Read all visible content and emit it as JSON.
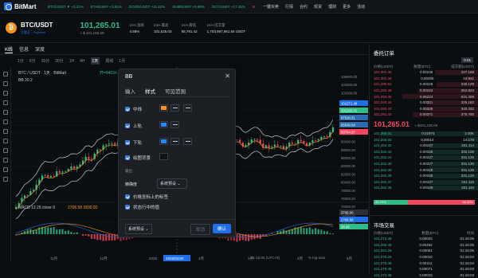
{
  "brand": "BitMart",
  "ticker": [
    {
      "t": "BTC/USDT ▼ +3.31%",
      "c": "up"
    },
    {
      "t": "ETH/USDT +3.81%",
      "c": "up"
    },
    {
      "t": "DOGE/USDT +11.62%",
      "c": "up"
    },
    {
      "t": "SHIB/USDT +9.96%",
      "c": "up"
    },
    {
      "t": "OCT/USDT +17.15%",
      "c": "up"
    },
    {
      "t": "BMX/USDT -1.35%",
      "c": "dn"
    }
  ],
  "topnav": [
    "一键买卖",
    "行情",
    "合约",
    "现货",
    "理财",
    "更多",
    "活动"
  ],
  "pair": {
    "name": "BTC/USDT",
    "sub": "主要区 · Payment",
    "price": "101,265.01",
    "sub_price": "≈ $ 101,236.59",
    "change_label": "24H 涨跌",
    "change": "4.58%",
    "high_label": "24H 最高",
    "high": "101,525.03",
    "low_label": "24H 最低",
    "low": "95,791.42",
    "vol_label": "24H 成交量",
    "vol": "1,703,997,961.64 USDT"
  },
  "chart_tabs": [
    "K线",
    "信息",
    "深度"
  ],
  "timeframes": [
    "1分",
    "5分",
    "15分",
    "30分",
    "1H",
    "4H",
    "1天",
    "周线",
    "1月"
  ],
  "selected_timeframe": "1天",
  "months": [
    "11月",
    "12月",
    "2025",
    "2月",
    "3月",
    "4月",
    "5月"
  ],
  "x_highlight": "2025/01/20",
  "chart_legend": "BTC / USDT · 1天 · BitMart",
  "ohlc": "开=94034.92 高=101535.73 低=...",
  "bb_label": "BB 20 2",
  "macd_label": "MACD 12 26 close 9",
  "macd_values": "2706.58  2830.92",
  "y_ticks": [
    "106000.00",
    "104000.00",
    "102000.00",
    "100000.00",
    "98000.00",
    "96000.00",
    "94000.00",
    "92000.00",
    "90000.00",
    "88000.00",
    "86000.00",
    "84000.00",
    "82000.00",
    "80000.00",
    "78000.00",
    "76000.00",
    "74000.00",
    "72000.00",
    "70000.00"
  ],
  "price_tags": [
    {
      "v": "101271.48",
      "c": "#1f6feb"
    },
    {
      "v": "101265.01",
      "c": "#2ebd85"
    },
    {
      "v": "97530.51",
      "c": "#2b6cb0"
    },
    {
      "v": "95630.64",
      "c": "#2b6cb0"
    },
    {
      "v": "93794.97",
      "c": "#f6465d"
    }
  ],
  "macd_tags": [
    {
      "v": "3706.00",
      "c": "#2b3139"
    },
    {
      "v": "2706.58",
      "c": "#1f6feb"
    },
    {
      "v": "38.06",
      "c": "#2ebd85"
    }
  ],
  "axis_time": "01:16:06 (UTC+8)",
  "axis_mode": "%  log  auto",
  "orderbook": {
    "title": "委托订单",
    "precision": "0.01",
    "cols": [
      "价格(USDT)",
      "数量(BTC)",
      "成交额(USDT)"
    ],
    "asks": [
      [
        "101,301.45",
        "0.02235",
        "227.168"
      ],
      [
        "101,301.44",
        "0.00205",
        "24.941"
      ],
      [
        "101,296.61",
        "0.00226",
        "230.129"
      ],
      [
        "101,293.46",
        "0.00343",
        "364.923"
      ],
      [
        "101,293.45",
        "0.06224",
        "631.459"
      ],
      [
        "101,293.44",
        "0.00321",
        "325.162"
      ],
      [
        "101,293.43",
        "0.00335",
        "340.332"
      ],
      [
        "101,291.44",
        "0.00371",
        "375.780"
      ]
    ],
    "mid": "101,265.01",
    "mid_sub": "≈ $101,236.59",
    "bids": [
      [
        "101,265.01",
        "0.01974",
        "2.00K"
      ],
      [
        "101,265.00",
        "0.00014",
        "14.178"
      ],
      [
        "101,262.43",
        "0.00327",
        "331.114"
      ],
      [
        "101,262.42",
        "0.00328",
        "332.108"
      ],
      [
        "101,262.41",
        "0.00327",
        "331.126"
      ],
      [
        "101,262.40",
        "0.00327",
        "331.130"
      ],
      [
        "101,262.39",
        "0.00328",
        "331.125"
      ],
      [
        "101,262.38",
        "0.00328",
        "331.120"
      ],
      [
        "101,262.37",
        "0.00327",
        "331.115"
      ],
      [
        "101,262.36",
        "0.00328",
        "331.110"
      ]
    ],
    "ratio_buy": "33.70%",
    "ratio_sell": "66.30%"
  },
  "trades": {
    "title": "市场交易",
    "cols": [
      "价格(USDT)",
      "数量(BTC)",
      "时间"
    ],
    "rows": [
      [
        "101,272.46",
        "0.00023",
        "01:16:06"
      ],
      [
        "101,265.46",
        "0.00492",
        "01:16:05"
      ],
      [
        "101,261.25",
        "0.00061",
        "01:16:05"
      ],
      [
        "101,270.26",
        "0.00010",
        "01:16:04"
      ],
      [
        "101,275.46",
        "0.00112",
        "01:16:04"
      ],
      [
        "101,279.46",
        "0.00071",
        "01:16:03"
      ],
      [
        "101,272.46",
        "0.00023",
        "01:16:03"
      ]
    ]
  },
  "modal": {
    "title": "BB",
    "tabs": [
      "输入",
      "样式",
      "可见范围"
    ],
    "rows": [
      {
        "label": "中线",
        "color": "#f7931a"
      },
      {
        "label": "上轨",
        "color": "#1f8bff"
      },
      {
        "label": "下轨",
        "color": "#1f8bff"
      }
    ],
    "bg_label": "绘图背景",
    "output_section": "输出",
    "precision_label": "精确度",
    "precision_value": "系统预设",
    "check1": "价格坐标上的标签",
    "check2": "状态行中的值",
    "template_label": "系统预设",
    "cancel": "取消",
    "ok": "确认"
  }
}
